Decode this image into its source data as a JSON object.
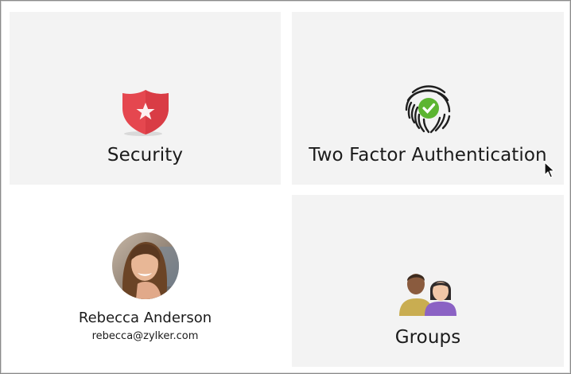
{
  "tiles": {
    "security": {
      "title": "Security",
      "icon": "shield-star-icon"
    },
    "two_factor": {
      "title": "Two Factor Authentication",
      "icon": "fingerprint-check-icon"
    },
    "groups": {
      "title": "Groups",
      "icon": "group-people-icon"
    }
  },
  "profile": {
    "name": "Rebecca Anderson",
    "email": "rebecca@zylker.com",
    "avatar": "avatar-photo"
  },
  "colors": {
    "tile_bg": "#f3f3f3",
    "shield_red": "#e5474f",
    "check_green": "#5cb531",
    "text": "#1b1b1b"
  },
  "cursor": "arrow-pointer-icon"
}
